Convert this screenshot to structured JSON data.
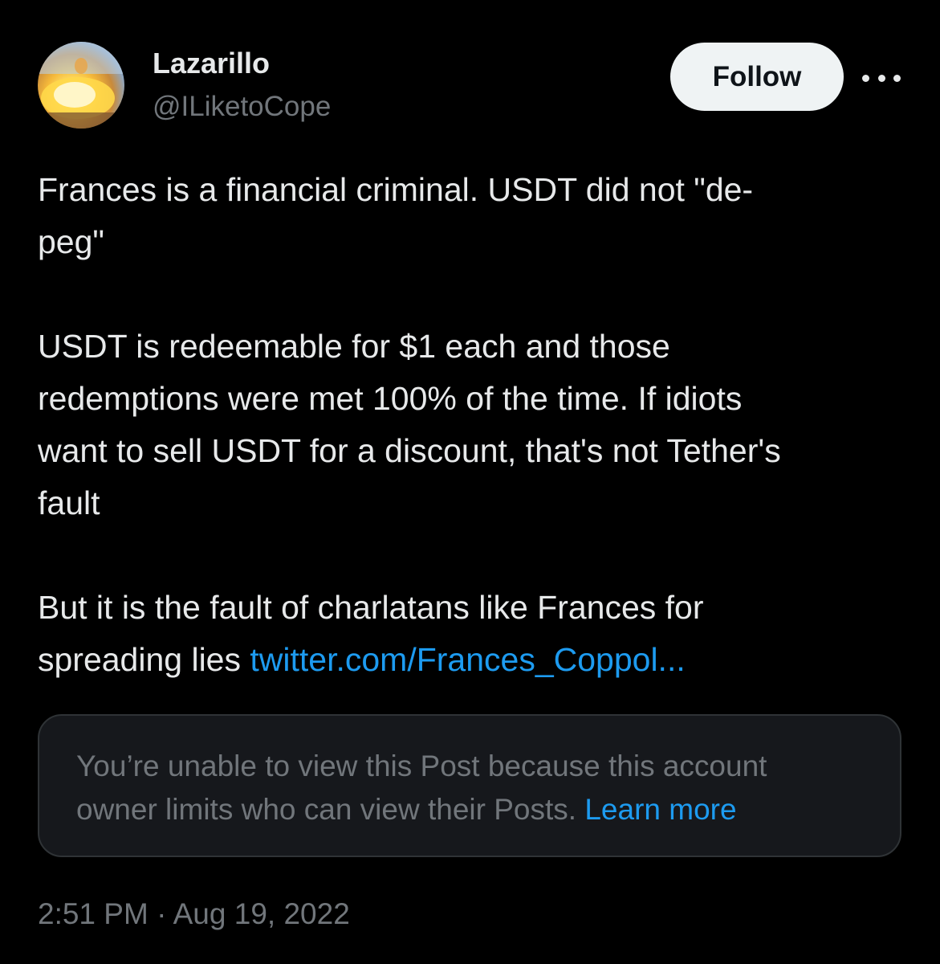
{
  "author": {
    "name": "Lazarillo",
    "handle": "@ILiketoCope"
  },
  "actions": {
    "follow_label": "Follow",
    "more_icon": "more-horizontal-icon"
  },
  "tweet": {
    "paragraphs": [
      [
        "Frances is a financial criminal. USDT did not \"de-",
        "peg\""
      ],
      [
        "USDT is redeemable for $1 each and those",
        "redemptions were met 100% of the time. If idiots",
        "want to sell USDT for a discount, that's not Tether's",
        "fault"
      ],
      [
        "But it is the fault of charlatans like Frances for"
      ]
    ],
    "last_line_text": "spreading lies ",
    "link_text": "twitter.com/Frances_Coppol..."
  },
  "quoted_notice": {
    "line1": "You’re unable to view this Post because this account",
    "line2": "owner limits who can view their Posts. ",
    "learn_more": "Learn more"
  },
  "timestamp": "2:51 PM · Aug 19, 2022",
  "colors": {
    "background": "#000000",
    "text": "#e7e9ea",
    "secondary": "#71767b",
    "link": "#1d9bf0",
    "button_bg": "#eff3f4"
  }
}
